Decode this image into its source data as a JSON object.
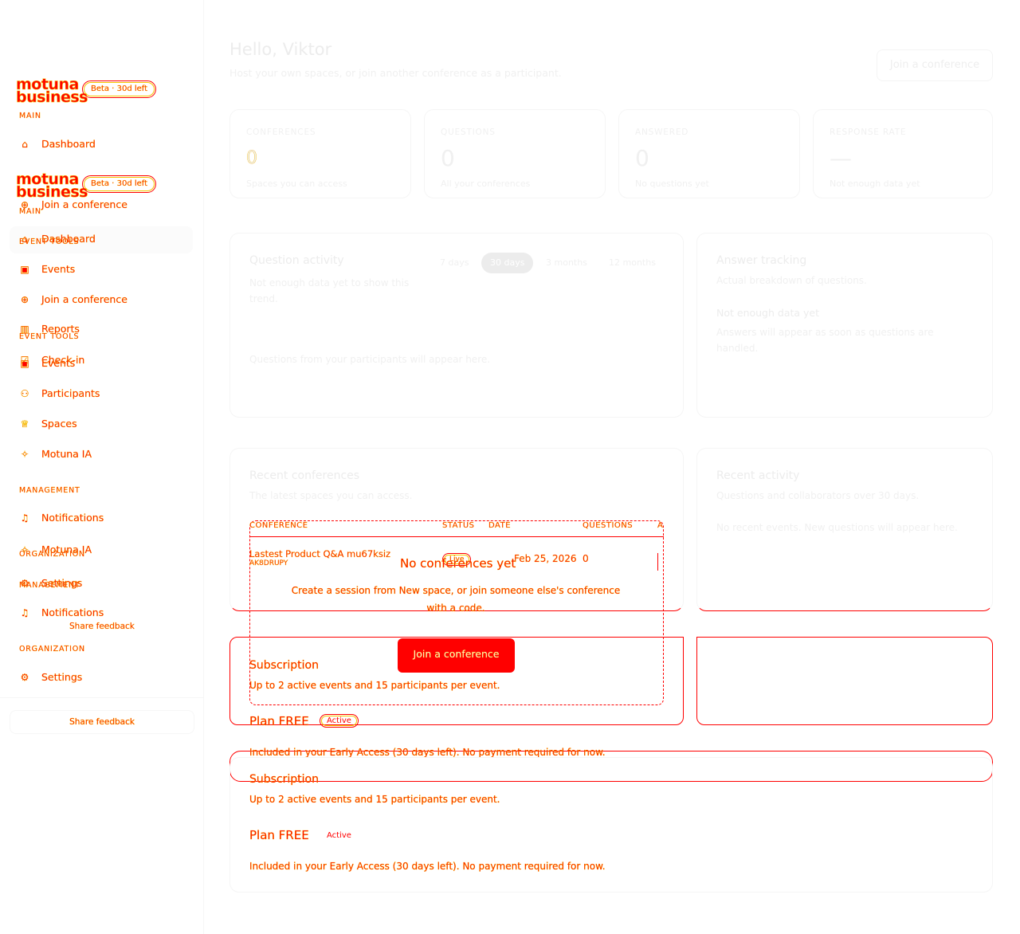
{
  "brand": {
    "logo_line1": "motuna",
    "logo_line2": "business",
    "beta_badge": "Beta · 30d left"
  },
  "sidebar": {
    "main_label": "MAIN",
    "dashboard": "Dashboard",
    "join": "Join a conference",
    "event_tools_label": "EVENT TOOLS",
    "events": "Events",
    "participants": "Participants",
    "spaces": "Spaces",
    "reports": "Reports",
    "checkin": "Check-in",
    "motuna_ia": "Motuna IA",
    "management_label": "MANAGEMENT",
    "notifications": "Notifications",
    "organization_label": "ORGANIZATION",
    "settings": "Settings",
    "feedback": "Share feedback"
  },
  "header": {
    "greeting": "Hello, Viktor",
    "subtitle": "Host your own spaces, or join another conference as a participant.",
    "join_button": "Join a conference"
  },
  "stats": [
    {
      "label": "CONFERENCES",
      "value": "0",
      "sub": "Spaces you can access"
    },
    {
      "label": "QUESTIONS",
      "value": "0",
      "sub": "All your conferences"
    },
    {
      "label": "ANSWERED",
      "value": "0",
      "sub": "No questions yet"
    },
    {
      "label": "RESPONSE RATE",
      "value": "—",
      "sub": "Not enough data yet"
    }
  ],
  "question_activity": {
    "title": "Question activity",
    "subtitle": "Not enough data yet to show this trend.",
    "ranges": [
      "7 days",
      "30 days",
      "3 months",
      "12 months"
    ],
    "active_range": "30 days",
    "empty": "Questions from your participants will appear here."
  },
  "answer_tracking": {
    "title": "Answer tracking",
    "subtitle": "Actual breakdown of questions.",
    "empty_title": "Not enough data yet",
    "empty_text": "Answers will appear as soon as questions are handled."
  },
  "recent_conferences": {
    "title": "Recent conferences",
    "subtitle": "The latest spaces you can access.",
    "columns": [
      "CONFERENCE",
      "STATUS",
      "DATE",
      "QUESTIONS",
      "A"
    ],
    "rows": [
      {
        "name": "Lastest Product Q&A mu67ksiz",
        "code": "AK8DRUPY",
        "status": "Live",
        "date": "Feb 25, 2026",
        "questions": "0"
      }
    ],
    "empty_title": "No conferences yet",
    "empty_text": "Create a session from New space, or join someone else's conference with a code.",
    "join_button": "Join a conference"
  },
  "recent_activity": {
    "title": "Recent activity",
    "subtitle": "Questions and collaborators over 30 days.",
    "empty": "No recent events. New questions will appear here."
  },
  "subscription": {
    "title": "Subscription",
    "subtitle": "Up to 2 active events and 15 participants per event.",
    "plan": "Plan FREE",
    "status": "Active",
    "note": "Included in your Early Access (30 days left). No payment required for now."
  },
  "colors": {
    "accent": "#ff0000",
    "outline": "#f5c400",
    "ghost_text": "#f0f0f0"
  }
}
